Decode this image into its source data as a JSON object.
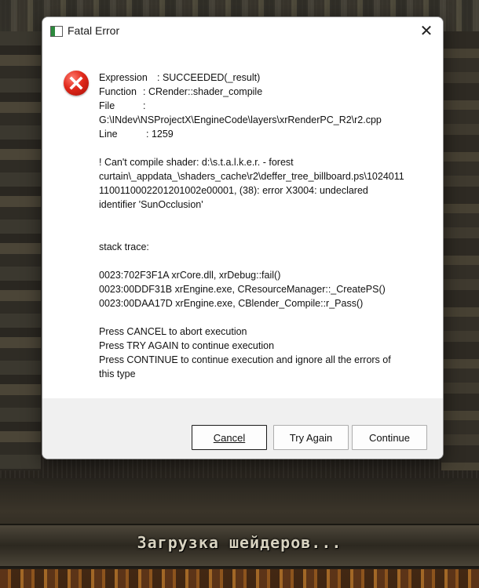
{
  "background": {
    "loading_text": "Загрузка шейдеров..."
  },
  "dialog": {
    "title": "Fatal Error",
    "icon": "error-icon",
    "expression_label": "Expression",
    "expression_value": ": SUCCEEDED(_result)",
    "function_label": "Function",
    "function_value": ": CRender::shader_compile",
    "file_label": "File",
    "file_colon": ":",
    "file_value": "G:\\INdev\\NSProjectX\\EngineCode\\layers\\xrRenderPC_R2\\r2.cpp",
    "line_label": "Line",
    "line_value": ": 1259",
    "message_lines": [
      "! Can't compile shader: d:\\s.t.a.l.k.e.r. - forest",
      "curtain\\_appdata_\\shaders_cache\\r2\\deffer_tree_billboard.ps\\1024011",
      "1100110002201201002e00001, (38): error X3004: undeclared",
      "identifier 'SunOcclusion'"
    ],
    "stack_title": "stack trace:",
    "stack_lines": [
      "0023:702F3F1A xrCore.dll, xrDebug::fail()",
      "0023:00DDF31B xrEngine.exe, CResourceManager::_CreatePS()",
      "0023:00DAA17D xrEngine.exe, CBlender_Compile::r_Pass()"
    ],
    "press_lines": [
      "Press CANCEL to abort execution",
      "Press TRY AGAIN to continue execution",
      "Press CONTINUE to continue execution and ignore all the errors of",
      "this type"
    ],
    "buttons": {
      "cancel": "Cancel",
      "try_again": "Try Again",
      "continue": "Continue"
    },
    "close_glyph": "✕"
  }
}
